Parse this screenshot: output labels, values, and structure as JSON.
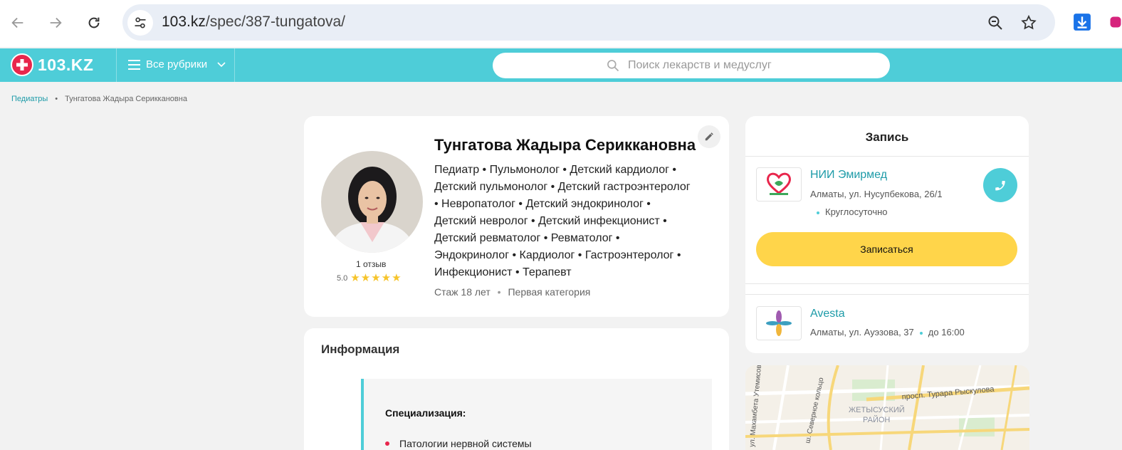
{
  "browser": {
    "url_host": "103.kz",
    "url_path": "/spec/387-tungatova/"
  },
  "site": {
    "logo_text": "103.KZ",
    "rubrics_label": "Все рубрики",
    "search_placeholder": "Поиск лекарств и медуслуг"
  },
  "breadcrumb": {
    "parent": "Педиатры",
    "separator": "•",
    "current": "Тунгатова Жадыра Сериккановна"
  },
  "doctor": {
    "name": "Тунгатова Жадыра Сериккановна",
    "spec_lines": [
      "Педиатр • Пульмонолог • Детский кардиолог •",
      "Детский пульмонолог • Детский гастроэнтеролог",
      "• Невропатолог • Детский эндокринолог •",
      "Детский невролог • Детский инфекционист •",
      "Детский ревматолог • Ревматолог •",
      "Эндокринолог • Кардиолог • Гастроэнтеролог •",
      "Инфекционист • Терапевт"
    ],
    "experience": "Стаж 18 лет",
    "category": "Первая категория",
    "dot": "•",
    "reviews": "1 отзыв",
    "rating": "5.0",
    "stars": 5
  },
  "info": {
    "title": "Информация",
    "section_heading": "Специализация:",
    "first_item": "Патологии нервной системы"
  },
  "booking": {
    "title": "Запись",
    "clinics": [
      {
        "name": "НИИ Эмирмед",
        "address": "Алматы, ул. Нусупбекова, 26/1",
        "hours": "Круглосуточно"
      },
      {
        "name": "Avesta",
        "address": "Алматы, ул. Ауэзова, 37",
        "hours": "до 16:00"
      }
    ],
    "button_label": "Записаться"
  },
  "map": {
    "labels": {
      "district": "ЖЕТЫСУСКИЙ",
      "district2": "РАЙОН",
      "avenue": "просп. Турара Рыскулова",
      "ring": "ш. Северное кольцо",
      "street": "ул. Махамбета Утемисова"
    }
  },
  "colors": {
    "accent": "#4ecdd8",
    "brand_red": "#e8264c",
    "button": "#ffd54a",
    "link": "#1d9ba8"
  }
}
